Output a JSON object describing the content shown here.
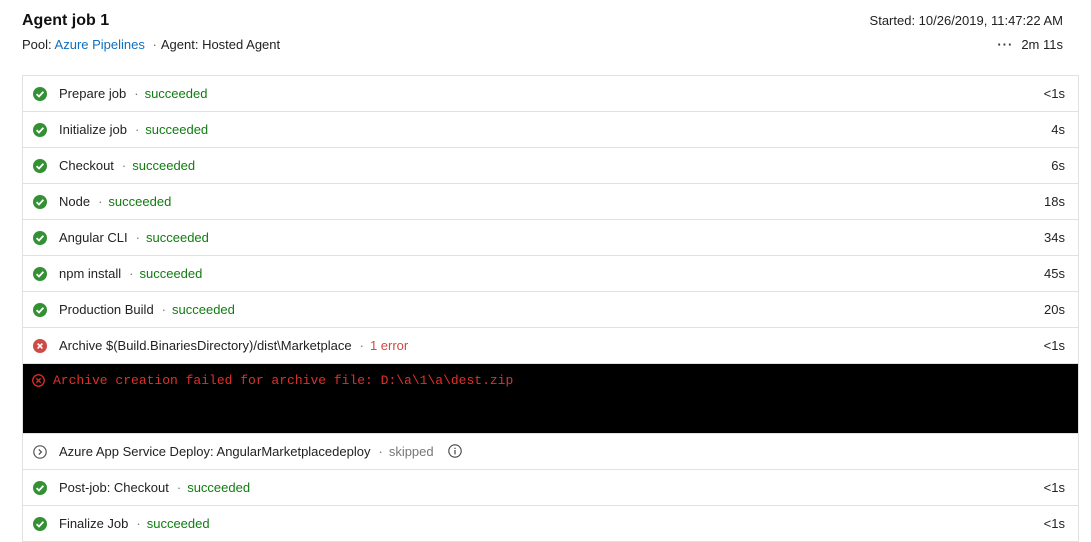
{
  "job": {
    "title": "Agent job 1",
    "pool_label": "Pool:",
    "pool_name": "Azure Pipelines",
    "separator": "·",
    "agent_label": "Agent:",
    "agent_name": "Hosted Agent",
    "started": "Started: 10/26/2019, 11:47:22 AM",
    "more_glyph": "···",
    "duration": "2m 11s"
  },
  "dot": "·",
  "colors": {
    "success": "#107c10",
    "error": "#cd4a45",
    "skipped": "#777777",
    "link": "#106ebe",
    "console_bg": "#000000",
    "console_error": "#e0302b"
  },
  "steps": [
    {
      "name": "Prepare job",
      "status": "succeeded",
      "time": "<1s",
      "icon": "check-circle-icon"
    },
    {
      "name": "Initialize job",
      "status": "succeeded",
      "time": "4s",
      "icon": "check-circle-icon"
    },
    {
      "name": "Checkout",
      "status": "succeeded",
      "time": "6s",
      "icon": "check-circle-icon"
    },
    {
      "name": "Node",
      "status": "succeeded",
      "time": "18s",
      "icon": "check-circle-icon"
    },
    {
      "name": "Angular CLI",
      "status": "succeeded",
      "time": "34s",
      "icon": "check-circle-icon"
    },
    {
      "name": "npm install",
      "status": "succeeded",
      "time": "45s",
      "icon": "check-circle-icon"
    },
    {
      "name": "Production Build",
      "status": "succeeded",
      "time": "20s",
      "icon": "check-circle-icon"
    },
    {
      "name": "Archive $(Build.BinariesDirectory)/dist\\Marketplace",
      "status": "1 error",
      "time": "<1s",
      "icon": "error-circle-icon"
    },
    {
      "name": "Azure App Service Deploy: AngularMarketplacedeploy",
      "status": "skipped",
      "time": "",
      "icon": "skip-circle-icon"
    },
    {
      "name": "Post-job: Checkout",
      "status": "succeeded",
      "time": "<1s",
      "icon": "check-circle-icon"
    },
    {
      "name": "Finalize Job",
      "status": "succeeded",
      "time": "<1s",
      "icon": "check-circle-icon"
    }
  ],
  "console": {
    "error_message": "Archive creation failed for archive file: D:\\a\\1\\a\\dest.zip",
    "icon": "error-circle-icon"
  }
}
